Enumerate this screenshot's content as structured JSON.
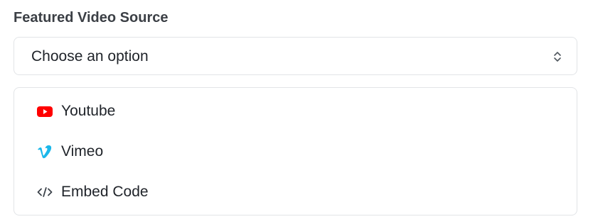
{
  "field": {
    "label": "Featured Video Source"
  },
  "select": {
    "value": "Choose an option",
    "chevron_icon": "chevron-updown-icon"
  },
  "options": [
    {
      "label": "Youtube",
      "icon": "youtube-icon",
      "color": "#ff0000"
    },
    {
      "label": "Vimeo",
      "icon": "vimeo-icon",
      "color": "#1ab7ea"
    },
    {
      "label": "Embed Code",
      "icon": "code-icon",
      "color": "#3c434a"
    }
  ]
}
